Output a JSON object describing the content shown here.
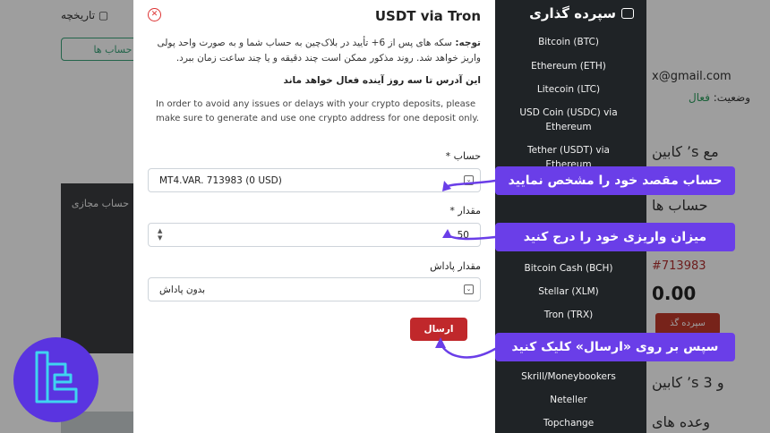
{
  "background": {
    "history_label": "تاریخچه",
    "open_account_label": "ن حساب ها",
    "card_label": "حساب مجازی",
    "email_fragment": "x@gmail.com",
    "status_label": "وضعیت:",
    "status_value": "فعال",
    "line1": "کابین ’s مع",
    "line2": "حساب ها",
    "account_id": "#713983",
    "balance": "0.00",
    "deposit_button": "سپرده گذ",
    "line3": "کابین ’s و 3",
    "line4": "وعده های"
  },
  "modal": {
    "title": "USDT via Tron",
    "close_icon": "close-icon",
    "note_label": "توجه:",
    "note_text": "سکه های پس از 6+ تأیید در بلاک‌چین به حساب شما و به صورت واحد پولی واریز خواهد شد. روند مذکور ممکن است چند دقیقه و یا چند ساعت زمان ببرد.",
    "note_bold": "این آدرس تا سه روز آینده فعال خواهد ماند",
    "note_english": "In order to avoid any issues or delays with your crypto deposits, please make sure to generate and use one crypto address for one deposit only.",
    "account_label": "حساب *",
    "account_value": "MT4.VAR. 713983 (0 USD)",
    "amount_label": "مقدار *",
    "amount_value": "50",
    "bonus_label": "مقدار پاداش",
    "bonus_value": "بدون پاداش",
    "submit_label": "ارسال"
  },
  "menu": {
    "title": "سپرده گذاری",
    "items": [
      "Bitcoin (BTC)",
      "Ethereum (ETH)",
      "Litecoin (LTC)",
      "USD Coin (USDC) via Ethereum",
      "Tether (USDT) via Ethereum",
      "Bitcoin Cash (BCH)",
      "Stellar (XLM)",
      "Tron (TRX)",
      "Skrill/Moneybookers",
      "Neteller",
      "Topchange"
    ]
  },
  "callouts": {
    "account": "حساب مقصد خود را مشخص نمایید",
    "amount": "میزان واریزی خود را درج کنید",
    "submit": "سپس بر روی «ارسال» کلیک کنید"
  },
  "colors": {
    "accent_purple": "#6a3ee8",
    "submit_red": "#c0282b",
    "menu_dark": "#1f2326"
  }
}
